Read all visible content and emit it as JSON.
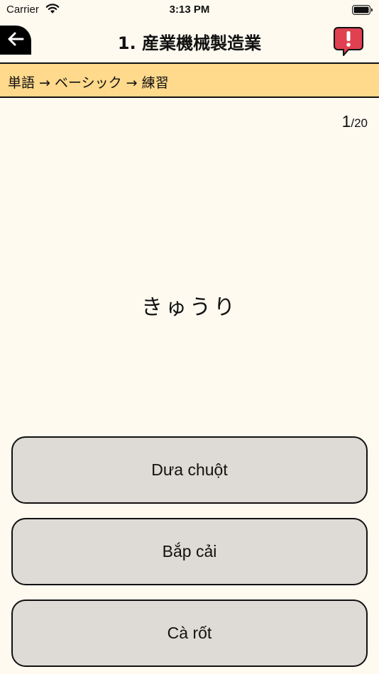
{
  "status_bar": {
    "carrier": "Carrier",
    "time": "3:13 PM"
  },
  "header": {
    "title": "1. 産業機械製造業",
    "back_icon": "arrow-left-icon",
    "report_icon": "exclamation-speech-bubble-icon"
  },
  "breadcrumb": "単語 → ベーシック → 練習",
  "progress": {
    "current": "1",
    "total": "/20"
  },
  "question": "きゅうり",
  "answers": [
    "Dưa chuột",
    "Bắp cải",
    "Cà rốt"
  ],
  "colors": {
    "background": "#fffaf0",
    "breadcrumb_bg": "#ffd98c",
    "answer_bg": "#dedad5",
    "report_red": "#e0404f",
    "border": "#111111"
  }
}
